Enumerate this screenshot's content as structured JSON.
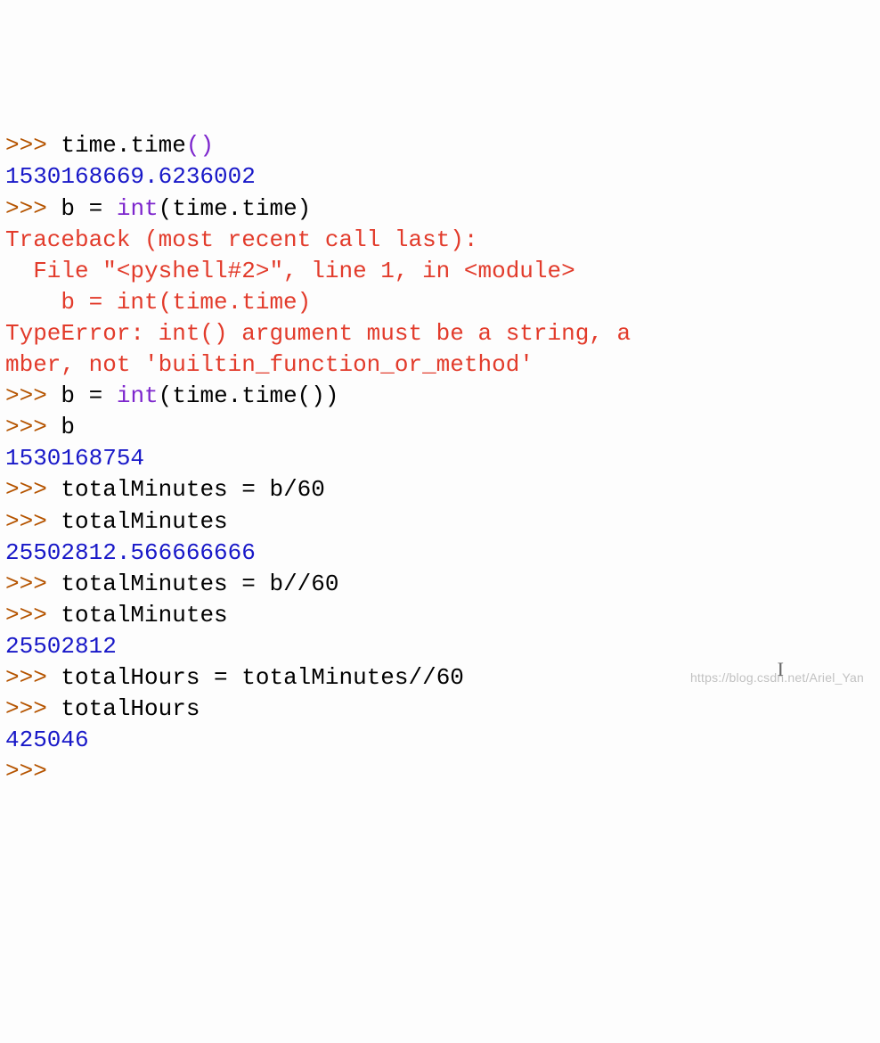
{
  "repl": {
    "prompt": ">>>",
    "lines": [
      {
        "type": "input",
        "code_parts": {
          "a": "time.",
          "b": "time",
          "c": "()"
        }
      },
      {
        "type": "output_num",
        "text": "1530168669.6236002"
      },
      {
        "type": "input",
        "code_parts": {
          "a": "b = ",
          "b": "int",
          "c": "(time.time)"
        }
      },
      {
        "type": "error",
        "text": "Traceback (most recent call last):"
      },
      {
        "type": "error",
        "text": "  File \"<pyshell#2>\", line 1, in <module>"
      },
      {
        "type": "error",
        "text": "    b = int(time.time)"
      },
      {
        "type": "error",
        "text": "TypeError: int() argument must be a string, a"
      },
      {
        "type": "error",
        "text": "mber, not 'builtin_function_or_method'"
      },
      {
        "type": "input",
        "code_parts": {
          "a": "b = ",
          "b": "int",
          "c": "(time.time())"
        }
      },
      {
        "type": "input",
        "code_parts": {
          "a": "b",
          "b": "",
          "c": ""
        }
      },
      {
        "type": "output_num",
        "text": "1530168754"
      },
      {
        "type": "input",
        "code_parts": {
          "a": "totalMinutes = b/60",
          "b": "",
          "c": ""
        }
      },
      {
        "type": "input",
        "code_parts": {
          "a": "totalMinutes",
          "b": "",
          "c": ""
        }
      },
      {
        "type": "output_num",
        "text": "25502812.566666666"
      },
      {
        "type": "input",
        "code_parts": {
          "a": "totalMinutes = b//60",
          "b": "",
          "c": ""
        }
      },
      {
        "type": "input",
        "code_parts": {
          "a": "totalMinutes",
          "b": "",
          "c": ""
        }
      },
      {
        "type": "output_num",
        "text": "25502812"
      },
      {
        "type": "input",
        "code_parts": {
          "a": "totalHours = totalMinutes//60",
          "b": "",
          "c": ""
        }
      },
      {
        "type": "input",
        "code_parts": {
          "a": "totalHours",
          "b": "",
          "c": ""
        }
      },
      {
        "type": "output_num",
        "text": "425046"
      },
      {
        "type": "input_empty"
      }
    ]
  },
  "watermark": "https://blog.csdn.net/Ariel_Yan"
}
